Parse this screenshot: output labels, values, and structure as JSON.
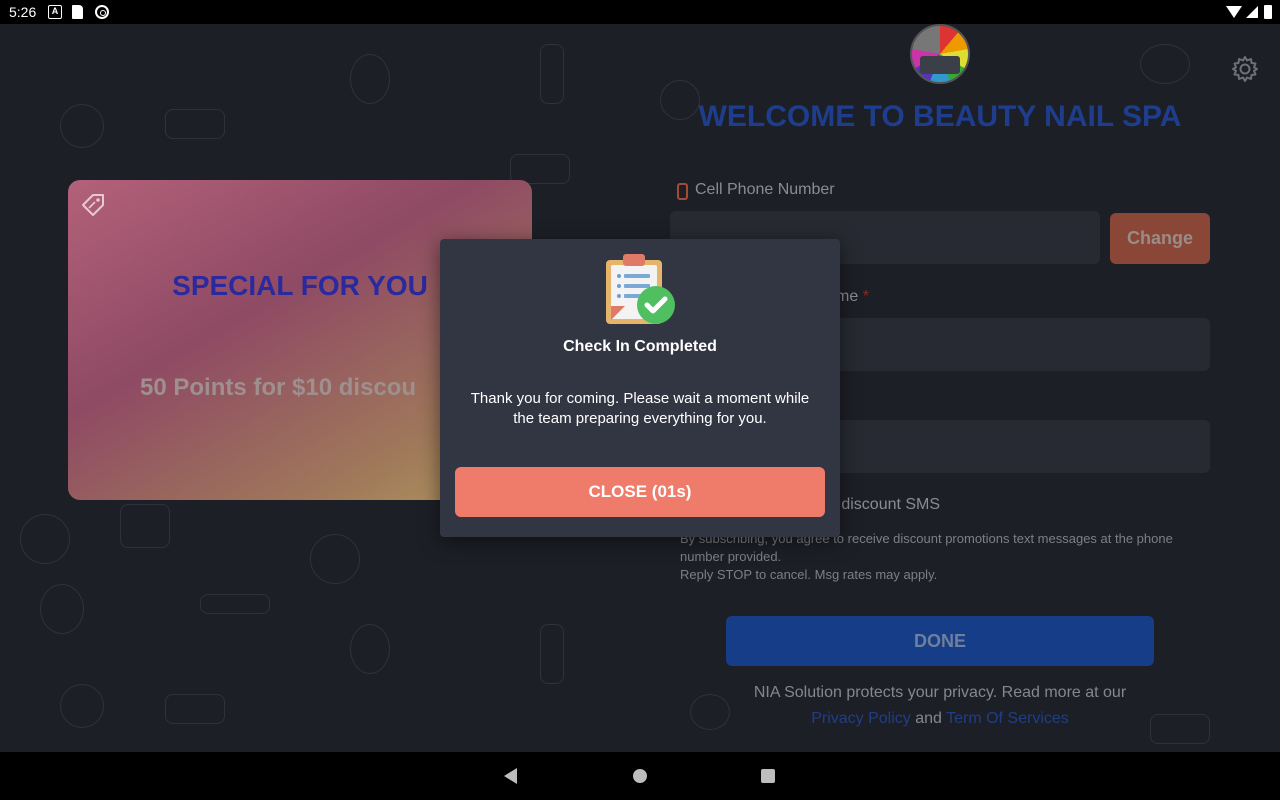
{
  "status_bar": {
    "time": "5:26"
  },
  "promo": {
    "title": "SPECIAL FOR YOU",
    "text": "50 Points for $10 discou"
  },
  "header": {
    "welcome": "WELCOME TO BEAUTY NAIL SPA"
  },
  "form": {
    "phone_label": "Cell Phone Number",
    "change_label": "Change",
    "name_label_fragment": "me",
    "name_required_mark": "*",
    "sms_label_fragment": "e discount SMS",
    "sms_terms_line1": "By subscribing, you agree to receive discount promotions text messages at the phone number provided.",
    "sms_terms_line2": "Reply STOP to cancel. Msg rates may apply.",
    "done_label": "DONE"
  },
  "privacy": {
    "text": "NIA Solution protects your privacy. Read more at our",
    "policy_link": "Privacy Policy",
    "and": "and",
    "terms_link": "Term Of Services"
  },
  "dialog": {
    "title": "Check In Completed",
    "message": "Thank you for coming. Please wait a moment while the team preparing everything for you.",
    "close_label": "CLOSE (01s)"
  },
  "colors": {
    "accent_close": "#ef7c6b",
    "welcome_blue": "#1e3d8c",
    "promo_title": "#2a2a9e"
  }
}
